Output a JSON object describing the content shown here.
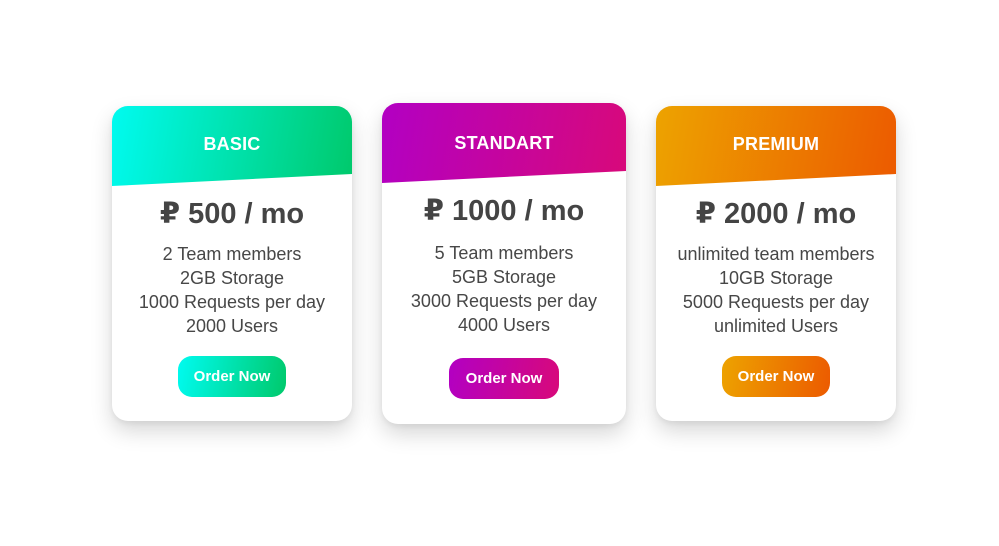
{
  "plans": [
    {
      "title": "BASIC",
      "price": "₽ 500 / mo",
      "features": [
        "2 Team members",
        "2GB Storage",
        "1000 Requests per day",
        "2000 Users"
      ],
      "button": "Order Now",
      "gradient": [
        "#00fbf0",
        "#00c96b"
      ]
    },
    {
      "title": "STANDART",
      "price": "₽ 1000 / mo",
      "features": [
        "5 Team members",
        "5GB Storage",
        "3000 Requests per day",
        "4000 Users"
      ],
      "button": "Order Now",
      "gradient": [
        "#b200c3",
        "#d8097a"
      ]
    },
    {
      "title": "PREMIUM",
      "price": "₽ 2000 / mo",
      "features": [
        "unlimited team members",
        "10GB Storage",
        "5000 Requests per day",
        "unlimited Users"
      ],
      "button": "Order Now",
      "gradient": [
        "#eda300",
        "#ec5a00"
      ]
    }
  ]
}
